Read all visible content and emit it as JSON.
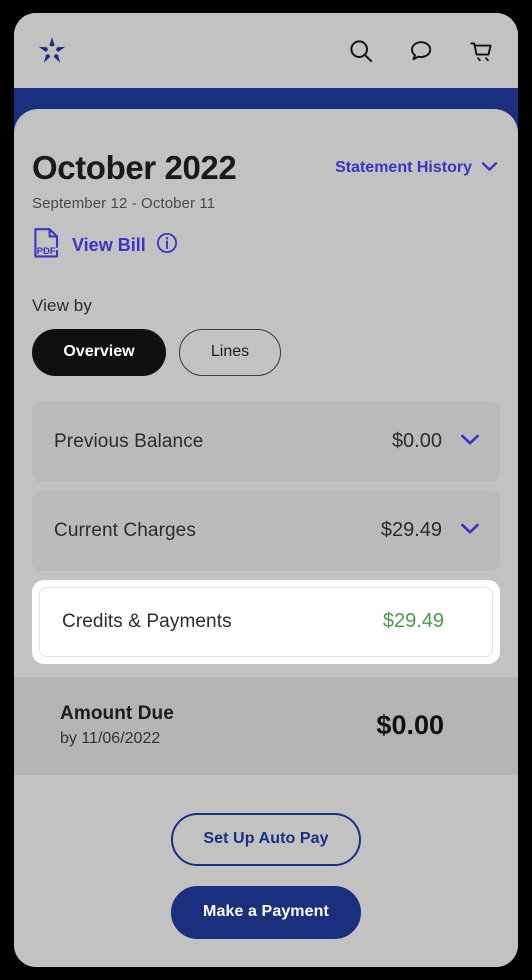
{
  "appbar": {
    "logo_name": "brand-star-logo",
    "logo_color": "#1b2f7f",
    "actions": [
      {
        "name": "search-icon",
        "label": "Search"
      },
      {
        "name": "chat-icon",
        "label": "Chat"
      },
      {
        "name": "cart-icon",
        "label": "Cart"
      }
    ]
  },
  "statement": {
    "month": "October 2022",
    "date_range": "September 12 - October 11",
    "history_link": "Statement History",
    "view_bill_label": "View Bill",
    "pdf_badge": "PDF",
    "info_glyph": "i"
  },
  "view_by": {
    "label": "View by",
    "options": [
      {
        "label": "Overview",
        "selected": true
      },
      {
        "label": "Lines",
        "selected": false
      }
    ]
  },
  "summary": {
    "rows": [
      {
        "label": "Previous Balance",
        "amount": "$0.00",
        "expandable": true,
        "highlighted": false,
        "credit": false
      },
      {
        "label": "Current Charges",
        "amount": "$29.49",
        "expandable": true,
        "highlighted": false,
        "credit": false
      },
      {
        "label": "Credits & Payments",
        "amount": "$29.49",
        "expandable": false,
        "highlighted": true,
        "credit": true
      }
    ]
  },
  "amount_due": {
    "title": "Amount Due",
    "due_date": "by 11/06/2022",
    "value": "$0.00"
  },
  "actions": {
    "autopay_label": "Set Up Auto Pay",
    "payment_label": "Make a Payment"
  },
  "colors": {
    "navy": "#1b2f7f",
    "link_indigo": "#3b34c4",
    "credit_green": "#4d9950",
    "page_gray": "#c2c2c2",
    "card_gray": "#bababa",
    "band_gray": "#b4b4b4"
  }
}
